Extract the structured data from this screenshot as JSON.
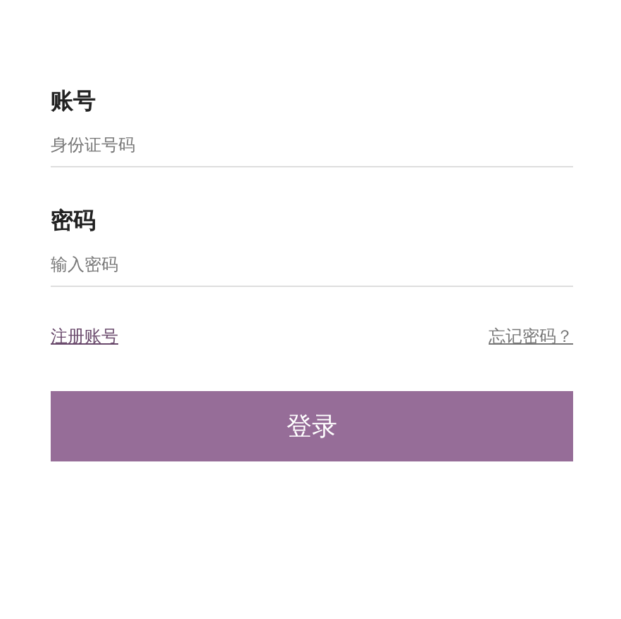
{
  "fields": [
    {
      "label": "账号",
      "placeholder": "身份证号码"
    },
    {
      "label": "密码",
      "placeholder": "输入密码"
    }
  ],
  "links": {
    "register": "注册账号",
    "forgot": "忘记密码？"
  },
  "submit": "登录"
}
